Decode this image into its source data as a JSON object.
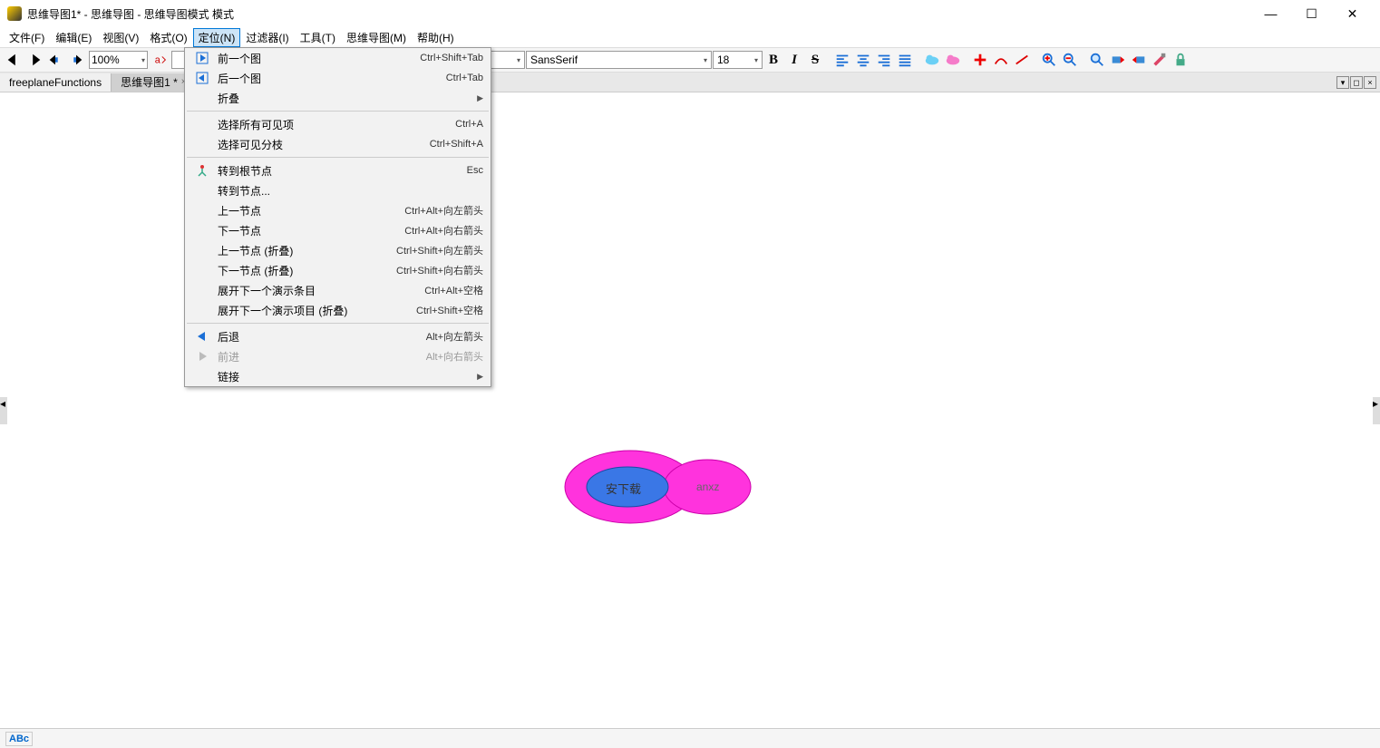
{
  "window": {
    "title": "思维导图1* - 思维导图 - 思维导图模式 模式"
  },
  "menu": {
    "file": "文件(F)",
    "edit": "编辑(E)",
    "view": "视图(V)",
    "format": "格式(O)",
    "navigate": "定位(N)",
    "filter": "过滤器(I)",
    "tools": "工具(T)",
    "mindmap": "思维导图(M)",
    "help": "帮助(H)"
  },
  "toolbar": {
    "zoom": "100%",
    "style": "",
    "font_name": "SansSerif",
    "font_size": "18"
  },
  "tabs": {
    "t1": "freeplaneFunctions",
    "t2": "思维导图1 *"
  },
  "dropdown": {
    "prev_map": {
      "label": "前一个图",
      "shortcut": "Ctrl+Shift+Tab"
    },
    "next_map": {
      "label": "后一个图",
      "shortcut": "Ctrl+Tab"
    },
    "fold": {
      "label": "折叠"
    },
    "select_all": {
      "label": "选择所有可见项",
      "shortcut": "Ctrl+A"
    },
    "select_branch": {
      "label": "选择可见分枝",
      "shortcut": "Ctrl+Shift+A"
    },
    "goto_root": {
      "label": "转到根节点",
      "shortcut": "Esc"
    },
    "goto_node": {
      "label": "转到节点..."
    },
    "prev_node": {
      "label": "上一节点",
      "shortcut": "Ctrl+Alt+向左箭头"
    },
    "next_node": {
      "label": "下一节点",
      "shortcut": "Ctrl+Alt+向右箭头"
    },
    "prev_node_fold": {
      "label": "上一节点 (折叠)",
      "shortcut": "Ctrl+Shift+向左箭头"
    },
    "next_node_fold": {
      "label": "下一节点 (折叠)",
      "shortcut": "Ctrl+Shift+向右箭头"
    },
    "next_pres": {
      "label": "展开下一个演示条目",
      "shortcut": "Ctrl+Alt+空格"
    },
    "next_pres_fold": {
      "label": "展开下一个演示项目 (折叠)",
      "shortcut": "Ctrl+Shift+空格"
    },
    "back": {
      "label": "后退",
      "shortcut": "Alt+向左箭头"
    },
    "forward": {
      "label": "前进",
      "shortcut": "Alt+向右箭头"
    },
    "link": {
      "label": "链接"
    }
  },
  "nodes": {
    "root": "安下载",
    "child": "anxz"
  },
  "status": {
    "spell": "ABc"
  }
}
